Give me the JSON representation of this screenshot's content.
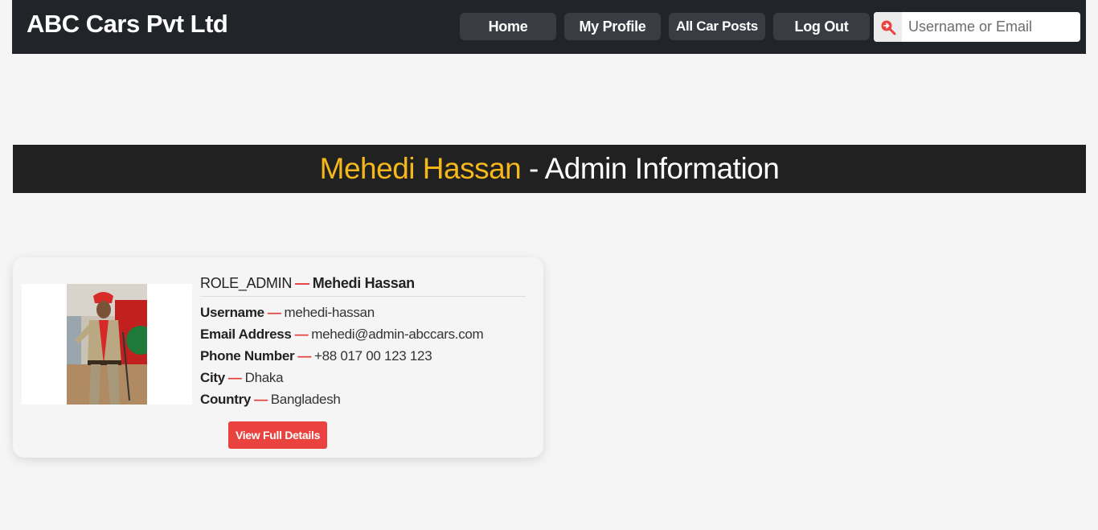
{
  "navbar": {
    "brand": "ABC Cars Pvt Ltd",
    "home": "Home",
    "my_profile": "My Profile",
    "all_car_posts": "All Car Posts",
    "log_out": "Log Out",
    "search_placeholder": "Username or Email",
    "search_icon": "search-arrow-icon"
  },
  "banner": {
    "name": "Mehedi Hassan",
    "suffix": " - Admin Information"
  },
  "card": {
    "role": "ROLE_ADMIN",
    "full_name": "Mehedi Hassan",
    "dash": "—",
    "fields": [
      {
        "label": "Username",
        "value": "mehedi-hassan"
      },
      {
        "label": "Email Address",
        "value": "mehedi@admin-abccars.com"
      },
      {
        "label": "Phone Number",
        "value": "+88 017 00 123 123"
      },
      {
        "label": "City",
        "value": "Dhaka"
      },
      {
        "label": "Country",
        "value": "Bangladesh"
      }
    ],
    "button": "View Full Details"
  },
  "colors": {
    "navbar_bg": "#212429",
    "accent_red": "#e9423f",
    "name_yellow": "#f4b71c"
  }
}
